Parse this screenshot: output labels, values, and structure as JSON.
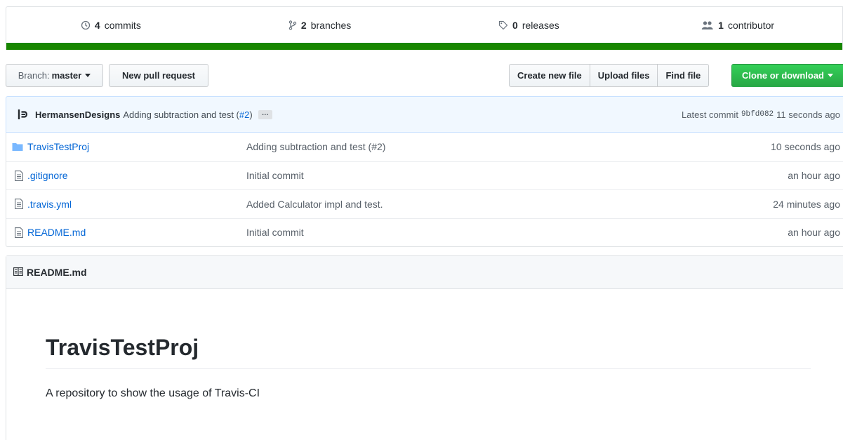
{
  "summary": {
    "commits": {
      "count": "4",
      "label": "commits"
    },
    "branches": {
      "count": "2",
      "label": "branches"
    },
    "releases": {
      "count": "0",
      "label": "releases"
    },
    "contributors": {
      "count": "1",
      "label": "contributor"
    },
    "language_color": "#178600"
  },
  "toolbar": {
    "branch_prefix": "Branch:",
    "branch_name": "master",
    "new_pr": "New pull request",
    "create_file": "Create new file",
    "upload_files": "Upload files",
    "find_file": "Find file",
    "clone": "Clone or download"
  },
  "commit": {
    "author": "HermansenDesigns",
    "message": "Adding subtraction and test (",
    "pr": "#2",
    "message_end": ")",
    "ellipsis": "…",
    "latest_label": "Latest commit",
    "sha": "9bfd082",
    "age": "11 seconds ago"
  },
  "files": [
    {
      "type": "folder",
      "name": "TravisTestProj",
      "message": "Adding subtraction and test (#2)",
      "age": "10 seconds ago"
    },
    {
      "type": "file",
      "name": ".gitignore",
      "message": "Initial commit",
      "age": "an hour ago"
    },
    {
      "type": "file",
      "name": ".travis.yml",
      "message": "Added Calculator impl and test.",
      "age": "24 minutes ago"
    },
    {
      "type": "file",
      "name": "README.md",
      "message": "Initial commit",
      "age": "an hour ago"
    }
  ],
  "readme": {
    "header": "README.md",
    "title": "TravisTestProj",
    "description": "A repository to show the usage of Travis-CI"
  }
}
